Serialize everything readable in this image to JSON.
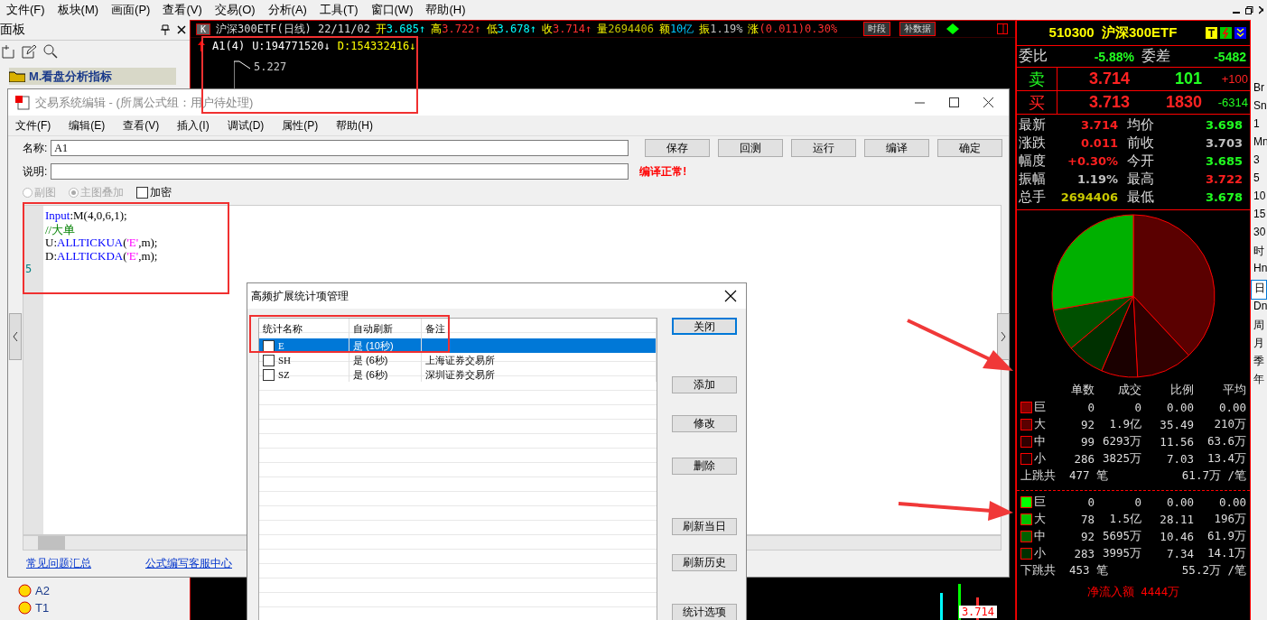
{
  "menubar": {
    "items": [
      "文件(F)",
      "板块(M)",
      "画面(P)",
      "查看(V)",
      "交易(O)",
      "分析(A)",
      "工具(T)",
      "窗口(W)",
      "帮助(H)"
    ]
  },
  "left_panel": {
    "title": "面板",
    "tree_items": [
      {
        "label": "M.看盘分析指标",
        "kind": "folder",
        "selected": true
      },
      {
        "label": "A2",
        "kind": "formula",
        "selected": false
      },
      {
        "label": "T1",
        "kind": "formula",
        "selected": false
      }
    ]
  },
  "chart": {
    "period_button": "K",
    "instrument": "沪深300ETF(日线) 22/11/02",
    "quotes": [
      {
        "label": "开",
        "value": "3.685↑",
        "color": "#00ffff"
      },
      {
        "label": "高",
        "value": "3.722↑",
        "color": "#ff3030"
      },
      {
        "label": "低",
        "value": "3.678↑",
        "color": "#00ffff"
      },
      {
        "label": "收",
        "value": "3.714↑",
        "color": "#ff3030"
      },
      {
        "label": "量",
        "value": "2694406",
        "color": "#c8c800"
      },
      {
        "label": "额",
        "value": "10亿",
        "color": "#00c8ff"
      },
      {
        "label": "振",
        "value": "1.19%",
        "color": "#c0c0c0"
      },
      {
        "label": "涨",
        "value": "(0.011)0.30%",
        "color": "#ff3030"
      }
    ],
    "buttons": [
      "时段",
      "补数据"
    ],
    "indicator": {
      "name": "A1(4)",
      "values": [
        {
          "text": "U:194771520↓",
          "color": "#ffffff"
        },
        {
          "text": "D:154332416↓",
          "color": "#ffff00"
        }
      ]
    },
    "peak_label": "5.227",
    "price_tag": "3.714"
  },
  "quote_panel": {
    "code": "510300",
    "name": "沪深300ETF",
    "ratio": {
      "label": "委比",
      "value": "-5.88%",
      "diff_label": "委差",
      "diff_value": "-5482"
    },
    "orders": [
      {
        "label": "卖",
        "price": "3.714",
        "volume": "101",
        "change": "+100",
        "kind": "sell"
      },
      {
        "label": "买",
        "price": "3.713",
        "volume": "1830",
        "change": "-6314",
        "kind": "buy"
      }
    ],
    "stats": [
      {
        "label": "最新",
        "value": "3.714",
        "color": "#ff2020"
      },
      {
        "label": "均价",
        "value": "3.698",
        "color": "#20ff20"
      },
      {
        "label": "涨跌",
        "value": "0.011",
        "color": "#ff2020"
      },
      {
        "label": "前收",
        "value": "3.703",
        "color": "#c0c0c0"
      },
      {
        "label": "幅度",
        "value": "+0.30%",
        "color": "#ff2020"
      },
      {
        "label": "今开",
        "value": "3.685",
        "color": "#20ff20"
      },
      {
        "label": "振幅",
        "value": "1.19%",
        "color": "#c0c0c0"
      },
      {
        "label": "最高",
        "value": "3.722",
        "color": "#ff2020"
      },
      {
        "label": "总手",
        "value": "2694406",
        "color": "#c8c800"
      },
      {
        "label": "最低",
        "value": "3.678",
        "color": "#20ff20"
      }
    ],
    "flow_columns": [
      "单数",
      "成交",
      "比例",
      "平均"
    ],
    "up_rows": [
      {
        "label": "巨",
        "color": "#800000",
        "cells": [
          "0",
          "0",
          "0.00",
          "0.00"
        ]
      },
      {
        "label": "大",
        "color": "#5a0000",
        "cells": [
          "92",
          "1.9亿",
          "35.49",
          "210万"
        ]
      },
      {
        "label": "中",
        "color": "#300000",
        "cells": [
          "99",
          "6293万",
          "11.56",
          "63.6万"
        ]
      },
      {
        "label": "小",
        "color": "#1a0000",
        "cells": [
          "286",
          "3825万",
          "7.03",
          "13.4万"
        ]
      }
    ],
    "up_total": {
      "label": "上跳共",
      "count": "477",
      "unit": "笔",
      "average": "61.7万 /笔"
    },
    "down_rows": [
      {
        "label": "巨",
        "color": "#00ff00",
        "cells": [
          "0",
          "0",
          "0.00",
          "0.00"
        ]
      },
      {
        "label": "大",
        "color": "#00c000",
        "cells": [
          "78",
          "1.5亿",
          "28.11",
          "196万"
        ]
      },
      {
        "label": "中",
        "color": "#006000",
        "cells": [
          "92",
          "5695万",
          "10.46",
          "61.9万"
        ]
      },
      {
        "label": "小",
        "color": "#003000",
        "cells": [
          "283",
          "3995万",
          "7.34",
          "14.1万"
        ]
      }
    ],
    "down_total": {
      "label": "下跳共",
      "count": "453",
      "unit": "笔",
      "average": "55.2万 /笔"
    },
    "net_inflow": "净流入额 4444万"
  },
  "period_strip": [
    {
      "label": "Br",
      "selected": false
    },
    {
      "label": "Sn",
      "selected": false
    },
    {
      "label": "1",
      "selected": false
    },
    {
      "label": "Mn",
      "selected": false
    },
    {
      "label": "3",
      "selected": false
    },
    {
      "label": "5",
      "selected": false
    },
    {
      "label": "10",
      "selected": false
    },
    {
      "label": "15",
      "selected": false
    },
    {
      "label": "30",
      "selected": false
    },
    {
      "label": "时",
      "selected": false
    },
    {
      "label": "Hn",
      "selected": false
    },
    {
      "label": "日",
      "selected": true
    },
    {
      "label": "Dn",
      "selected": false
    },
    {
      "label": "周",
      "selected": false
    },
    {
      "label": "月",
      "selected": false
    },
    {
      "label": "季",
      "selected": false
    },
    {
      "label": "年",
      "selected": false
    }
  ],
  "editor": {
    "title": "交易系统编辑 - (所属公式组：用户待处理)",
    "menu": [
      "文件(F)",
      "编辑(E)",
      "查看(V)",
      "插入(I)",
      "调试(D)",
      "属性(P)",
      "帮助(H)"
    ],
    "name_label": "名称:",
    "name_value": "A1",
    "desc_label": "说明:",
    "buttons": [
      "保存",
      "回测",
      "运行",
      "编译",
      "确定"
    ],
    "status": "编译正常!",
    "options": [
      {
        "label": "副图",
        "kind": "radio",
        "selected": false,
        "disabled": true
      },
      {
        "label": "主图叠加",
        "kind": "radio",
        "selected": true,
        "disabled": true
      },
      {
        "label": "加密",
        "kind": "checkbox",
        "checked": false,
        "disabled": false
      }
    ],
    "code_lines": [
      [
        {
          "text": "Input",
          "kind": "keyword"
        },
        {
          "text": ":M(4,0,6,1);",
          "kind": "plain"
        }
      ],
      [
        {
          "text": "//大单",
          "kind": "comment"
        }
      ],
      [
        {
          "text": "U:",
          "kind": "plain"
        },
        {
          "text": "ALLTICKUA",
          "kind": "keyword"
        },
        {
          "text": "(",
          "kind": "plain"
        },
        {
          "text": "'E'",
          "kind": "string"
        },
        {
          "text": ",m);",
          "kind": "plain"
        }
      ],
      [
        {
          "text": "D:",
          "kind": "plain"
        },
        {
          "text": "ALLTICKDA",
          "kind": "keyword"
        },
        {
          "text": "(",
          "kind": "plain"
        },
        {
          "text": "'E'",
          "kind": "string"
        },
        {
          "text": ",m);",
          "kind": "plain"
        }
      ]
    ],
    "gutter_number": "5",
    "links": [
      "常见问题汇总",
      "公式编写客服中心"
    ]
  },
  "stats_dialog": {
    "title": "高频扩展统计项管理",
    "columns": [
      "统计名称",
      "自动刷新",
      "备注"
    ],
    "rows": [
      {
        "name": "E",
        "refresh": "是 (10秒)",
        "selected": true,
        "checked": false
      },
      {
        "name": "SH",
        "refresh": "是 (6秒)",
        "note": "上海证券交易所",
        "selected": false,
        "checked": false
      },
      {
        "name": "SZ",
        "refresh": "是 (6秒)",
        "note": "深圳证券交易所",
        "selected": false,
        "checked": false
      }
    ],
    "buttons": [
      {
        "label": "关闭",
        "default": true
      },
      {
        "label": "添加",
        "default": false
      },
      {
        "label": "修改",
        "default": false
      },
      {
        "label": "删除",
        "default": false
      },
      {
        "label": "刷新当日",
        "default": false
      },
      {
        "label": "刷新历史",
        "default": false
      },
      {
        "label": "统计选项",
        "default": false
      }
    ]
  }
}
